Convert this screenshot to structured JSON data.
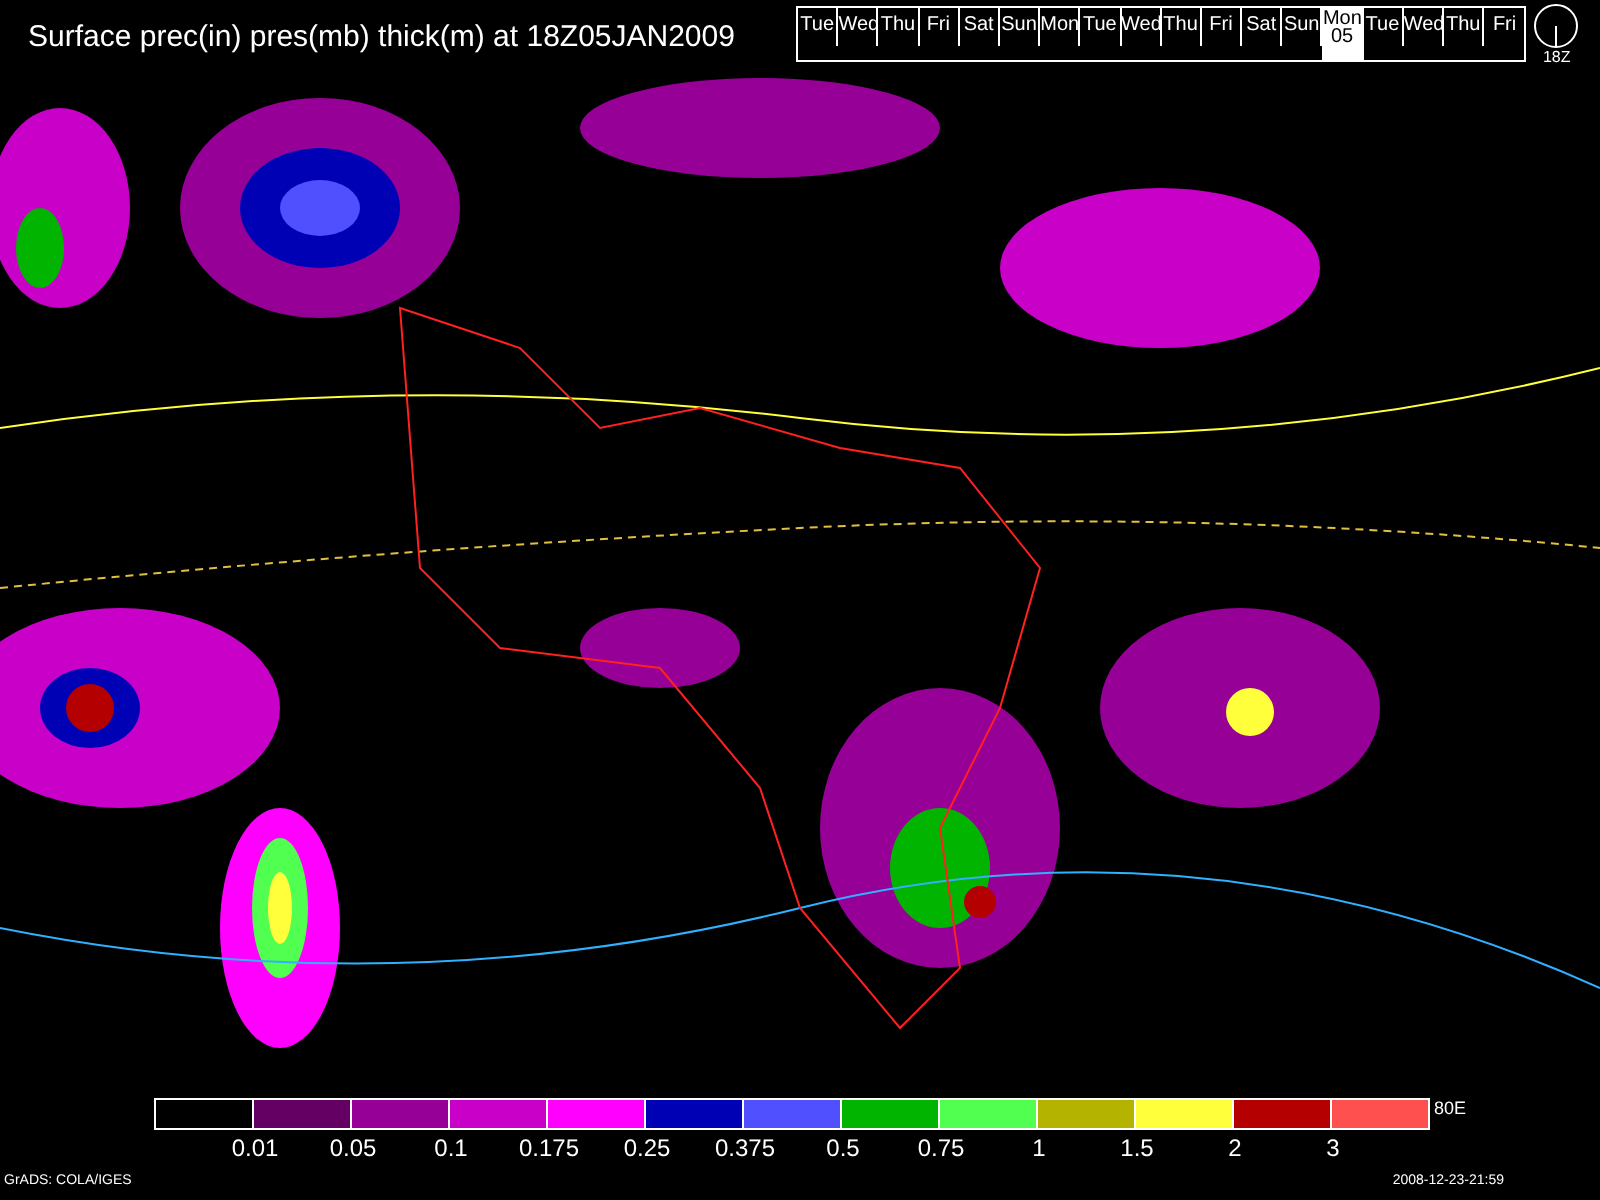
{
  "title": "Surface prec(in) pres(mb) thick(m) at 18Z05JAN2009",
  "days": [
    {
      "label": "Tue",
      "selected": false
    },
    {
      "label": "Wed",
      "selected": false
    },
    {
      "label": "Thu",
      "selected": false
    },
    {
      "label": "Fri",
      "selected": false
    },
    {
      "label": "Sat",
      "selected": false
    },
    {
      "label": "Sun",
      "selected": false
    },
    {
      "label": "Mon",
      "selected": false
    },
    {
      "label": "Tue",
      "selected": false
    },
    {
      "label": "Wed",
      "selected": false
    },
    {
      "label": "Thu",
      "selected": false
    },
    {
      "label": "Fri",
      "selected": false
    },
    {
      "label": "Sat",
      "selected": false
    },
    {
      "label": "Sun",
      "selected": false
    },
    {
      "label": "Mon",
      "date": "05",
      "selected": true
    },
    {
      "label": "Tue",
      "selected": false
    },
    {
      "label": "Wed",
      "selected": false
    },
    {
      "label": "Thu",
      "selected": false
    },
    {
      "label": "Fri",
      "selected": false
    }
  ],
  "clock": {
    "label": "18Z"
  },
  "legend": {
    "swatches": [
      {
        "color": "#000000"
      },
      {
        "color": "#640064"
      },
      {
        "color": "#960096"
      },
      {
        "color": "#c800c8"
      },
      {
        "color": "#ff00ff"
      },
      {
        "color": "#0000b4"
      },
      {
        "color": "#5050ff"
      },
      {
        "color": "#00b400"
      },
      {
        "color": "#50ff50"
      },
      {
        "color": "#b4b400"
      },
      {
        "color": "#ffff3c"
      },
      {
        "color": "#b40000"
      },
      {
        "color": "#ff5050"
      }
    ],
    "labels": [
      "0.01",
      "0.05",
      "0.1",
      "0.175",
      "0.25",
      "0.375",
      "0.5",
      "0.75",
      "1",
      "1.5",
      "2",
      "3"
    ],
    "edge_label": "80E"
  },
  "footer": {
    "left": "GrADS: COLA/IGES",
    "right": "2008-12-23-21:59"
  }
}
